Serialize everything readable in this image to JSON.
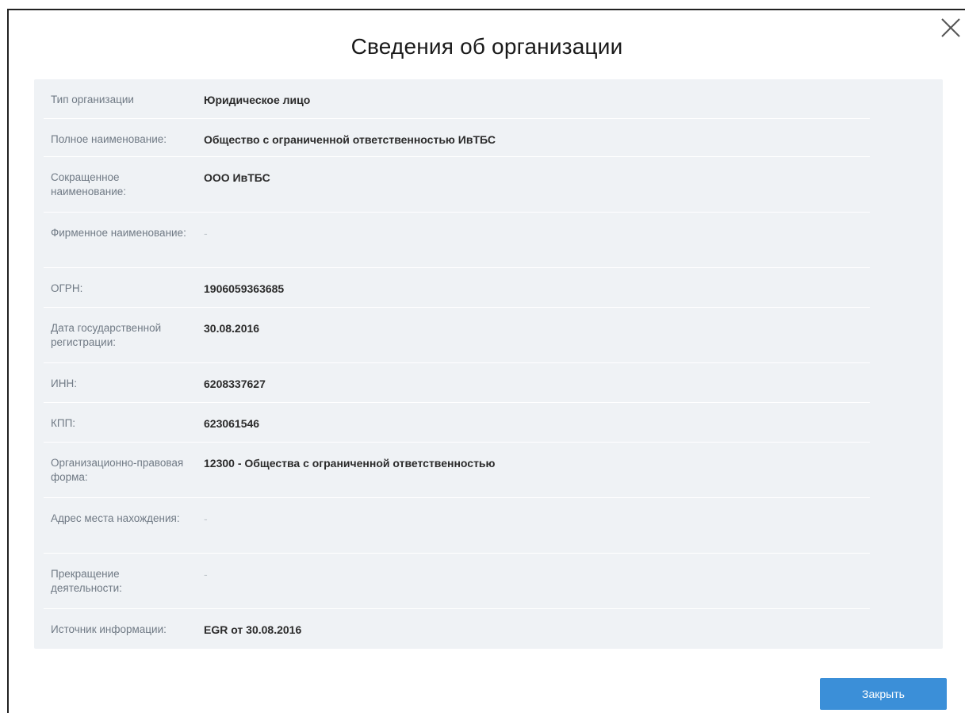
{
  "dialog": {
    "title": "Сведения об организации",
    "close_icon": "close-icon",
    "close_button_label": "Закрыть",
    "accent_color": "#3b8fd8"
  },
  "rows": [
    {
      "label": "Тип организации",
      "value": "Юридическое лицо"
    },
    {
      "label": "Полное наименование:",
      "value": "Общество с ограниченной ответственностью ИвТБС"
    },
    {
      "label": "Сокращенное наименование:",
      "value": "ООО ИвТБС"
    },
    {
      "label": "Фирменное наименование:",
      "value": "-"
    },
    {
      "label": "ОГРН:",
      "value": "1906059363685"
    },
    {
      "label": "Дата государственной регистрации:",
      "value": "30.08.2016"
    },
    {
      "label": "ИНН:",
      "value": "6208337627"
    },
    {
      "label": "КПП:",
      "value": "623061546"
    },
    {
      "label": "Организационно-правовая форма:",
      "value": "12300 - Общества с ограниченной ответственностью"
    },
    {
      "label": "Адрес места нахождения:",
      "value": "-"
    },
    {
      "label": "Прекращение деятельности:",
      "value": "-"
    },
    {
      "label": "Источник информации:",
      "value": "EGR от 30.08.2016"
    }
  ]
}
